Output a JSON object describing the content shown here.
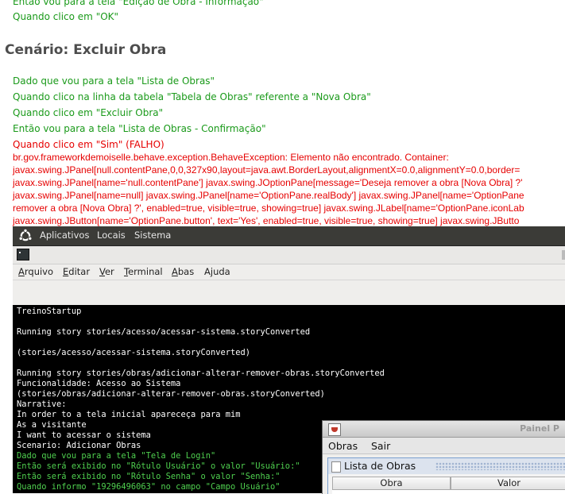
{
  "report": {
    "prev_steps": [
      "Então vou para a tela \"Edição de Obra - Informação\"",
      "Quando clico em \"OK\""
    ],
    "scenario_title": "Cenário: Excluir Obra",
    "steps": [
      "Dado que vou para a tela \"Lista de Obras\"",
      "Quando clico na linha da tabela \"Tabela de Obras\" referente a \"Nova Obra\"",
      "Quando clico em \"Excluir Obra\"",
      "Então vou para a tela \"Lista de Obras - Confirmação\""
    ],
    "failed_step": "Quando clico em \"Sim\"    (FALHO)",
    "error_lines": [
      "br.gov.frameworkdemoiselle.behave.exception.BehaveException: Elemento não encontrado. Container:",
      "javax.swing.JPanel[null.contentPane,0,0,327x90,layout=java.awt.BorderLayout,alignmentX=0.0,alignmentY=0.0,border=",
      "javax.swing.JPanel[name='null.contentPane'] javax.swing.JOptionPane[message='Deseja remover a obra [Nova Obra] ?'",
      "javax.swing.JPanel[name=null] javax.swing.JPanel[name='OptionPane.realBody'] javax.swing.JPanel[name='OptionPane",
      "remover a obra [Nova Obra] ?', enabled=true, visible=true, showing=true] javax.swing.JLabel[name='OptionPane.iconLab",
      "javax.swing.JButton[name='OptionPane.button', text='Yes', enabled=true, visible=true, showing=true] javax.swing.JButto"
    ]
  },
  "panel": {
    "menus": [
      "Aplicativos",
      "Locais",
      "Sistema"
    ]
  },
  "terminal": {
    "menu": [
      {
        "key": "A",
        "rest": "rquivo"
      },
      {
        "key": "E",
        "rest": "ditar"
      },
      {
        "key": "V",
        "rest": "er"
      },
      {
        "key": "T",
        "rest": "erminal"
      },
      {
        "key": "A",
        "rest": "bas",
        "pre": ""
      },
      {
        "key": "j",
        "rest": "uda",
        "pre": "A"
      }
    ],
    "lines": [
      {
        "text": "TreinoStartup",
        "green": false
      },
      {
        "text": "",
        "green": false
      },
      {
        "text": "Running story stories/acesso/acessar-sistema.storyConverted",
        "green": false
      },
      {
        "text": "",
        "green": false
      },
      {
        "text": "(stories/acesso/acessar-sistema.storyConverted)",
        "green": false
      },
      {
        "text": "",
        "green": false
      },
      {
        "text": "Running story stories/obras/adicionar-alterar-remover-obras.storyConverted",
        "green": false
      },
      {
        "text": "Funcionalidade: Acesso ao Sistema",
        "green": false
      },
      {
        "text": "(stories/obras/adicionar-alterar-remover-obras.storyConverted)",
        "green": false
      },
      {
        "text": "Narrative:",
        "green": false
      },
      {
        "text": "In order to a tela inicial apareceça para mim",
        "green": false
      },
      {
        "text": "As a visitante",
        "green": false
      },
      {
        "text": "I want to acessar o sistema",
        "green": false
      },
      {
        "text": "Scenario: Adicionar Obras",
        "green": false
      },
      {
        "text": "Dado que vou para a tela \"Tela de Login\"",
        "green": true
      },
      {
        "text": "Então será exibido no \"Rótulo Usuário\" o valor \"Usuário:\"",
        "green": true
      },
      {
        "text": "Então será exibido no \"Rótulo Senha\" o valor \"Senha:\"",
        "green": true
      },
      {
        "text": "Quando informo \"19296496063\" no campo \"Campo Usuário\"",
        "green": true
      }
    ]
  },
  "java_window": {
    "title": "Painel P",
    "menus": [
      "Obras",
      "Sair"
    ],
    "internal_frame_title": "Lista de Obras",
    "columns": [
      "Obra",
      "Valor"
    ]
  }
}
